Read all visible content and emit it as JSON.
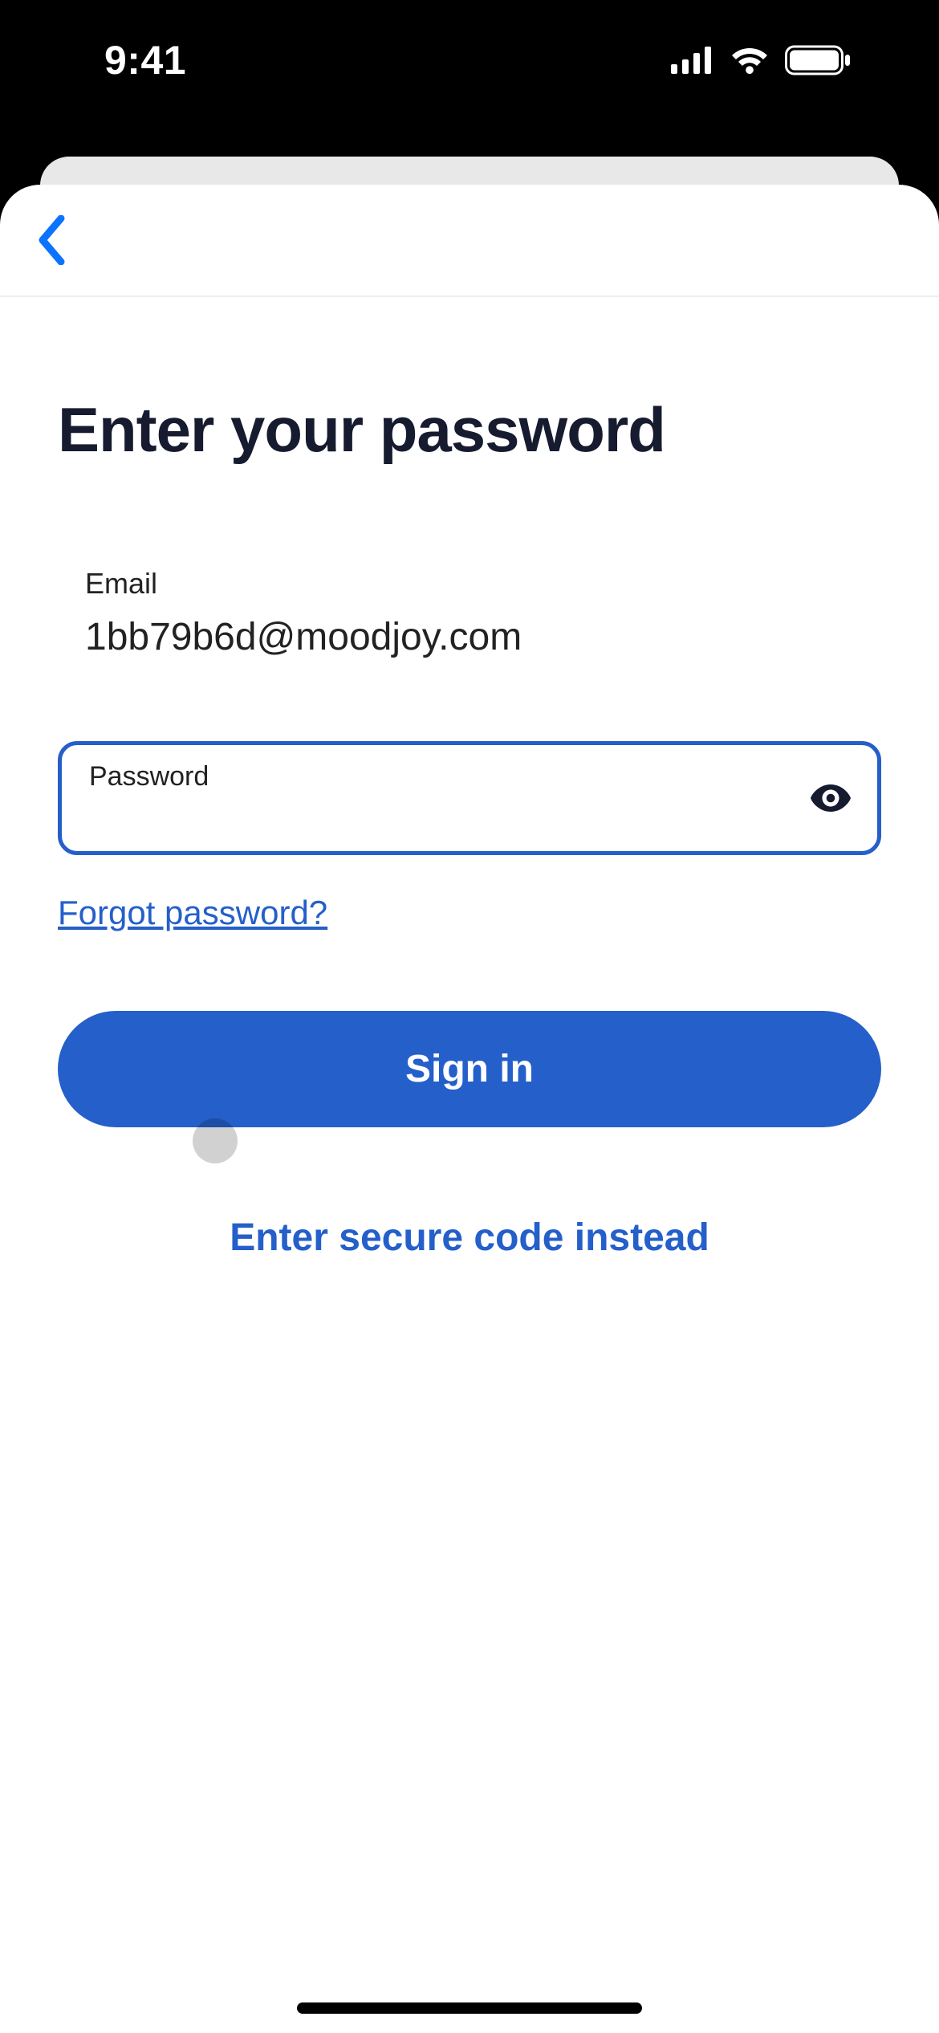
{
  "statusbar": {
    "time": "9:41"
  },
  "page": {
    "title": "Enter your password",
    "email_label": "Email",
    "email_value": "1bb79b6d@moodjoy.com",
    "password_label": "Password",
    "password_value": "",
    "forgot_password": "Forgot password?",
    "sign_in": "Sign in",
    "secure_code": "Enter secure code instead"
  },
  "icons": {
    "back": "chevron-left-icon",
    "eye": "eye-icon",
    "signal": "cellular-signal-icon",
    "wifi": "wifi-icon",
    "battery": "battery-icon"
  },
  "colors": {
    "primary": "#245fca",
    "text": "#171b2f"
  }
}
